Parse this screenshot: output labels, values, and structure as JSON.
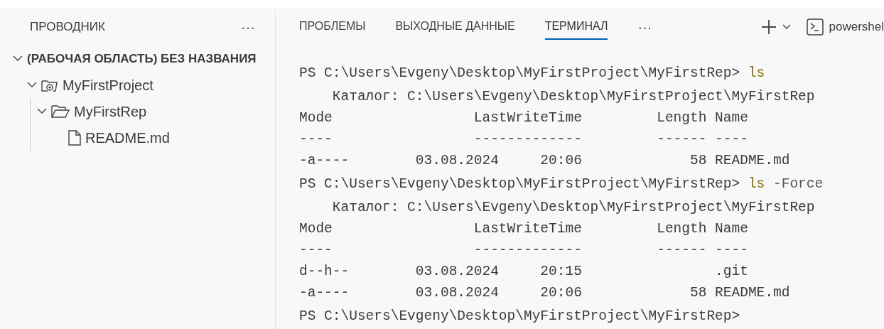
{
  "sidebar": {
    "title": "ПРОВОДНИК",
    "more": "···",
    "tree": [
      {
        "label": "(РАБОЧАЯ ОБЛАСТЬ) БЕЗ НАЗВАНИЯ",
        "kind": "workspace",
        "expanded": true,
        "children": [
          {
            "label": "MyFirstProject",
            "kind": "repo",
            "expanded": true,
            "children": [
              {
                "label": "MyFirstRep",
                "kind": "folder",
                "expanded": true,
                "children": [
                  {
                    "label": "README.md",
                    "kind": "file"
                  }
                ]
              }
            ]
          }
        ]
      }
    ]
  },
  "panel": {
    "tabs": [
      {
        "label": "ПРОБЛЕМЫ",
        "selected": false
      },
      {
        "label": "ВЫХОДНЫЕ ДАННЫЕ",
        "selected": false
      },
      {
        "label": "ТЕРМИНАЛ",
        "selected": true
      }
    ],
    "more": "···",
    "terminal_name": "powershel"
  },
  "terminal": {
    "lines": [
      {
        "kind": "prompt",
        "text": "PS C:\\Users\\Evgeny\\Desktop\\MyFirstProject\\MyFirstRep> ",
        "command": "ls"
      },
      {
        "kind": "output",
        "text": "    Каталог: C:\\Users\\Evgeny\\Desktop\\MyFirstProject\\MyFirstRep"
      },
      {
        "kind": "output",
        "text": "Mode                 LastWriteTime         Length Name"
      },
      {
        "kind": "output",
        "text": "----                 -------------         ------ ----"
      },
      {
        "kind": "output",
        "text": "-a----        03.08.2024     20:06             58 README.md"
      },
      {
        "kind": "prompt",
        "text": "PS C:\\Users\\Evgeny\\Desktop\\MyFirstProject\\MyFirstRep> ",
        "command": "ls",
        "args": " -Force"
      },
      {
        "kind": "output",
        "text": "    Каталог: C:\\Users\\Evgeny\\Desktop\\MyFirstProject\\MyFirstRep"
      },
      {
        "kind": "output",
        "text": "Mode                 LastWriteTime         Length Name"
      },
      {
        "kind": "output",
        "text": "----                 -------------         ------ ----"
      },
      {
        "kind": "output",
        "text": "d--h--        03.08.2024     20:15                .git"
      },
      {
        "kind": "output",
        "text": "-a----        03.08.2024     20:06             58 README.md"
      },
      {
        "kind": "prompt",
        "text": "PS C:\\Users\\Evgeny\\Desktop\\MyFirstProject\\MyFirstRep>"
      }
    ]
  }
}
